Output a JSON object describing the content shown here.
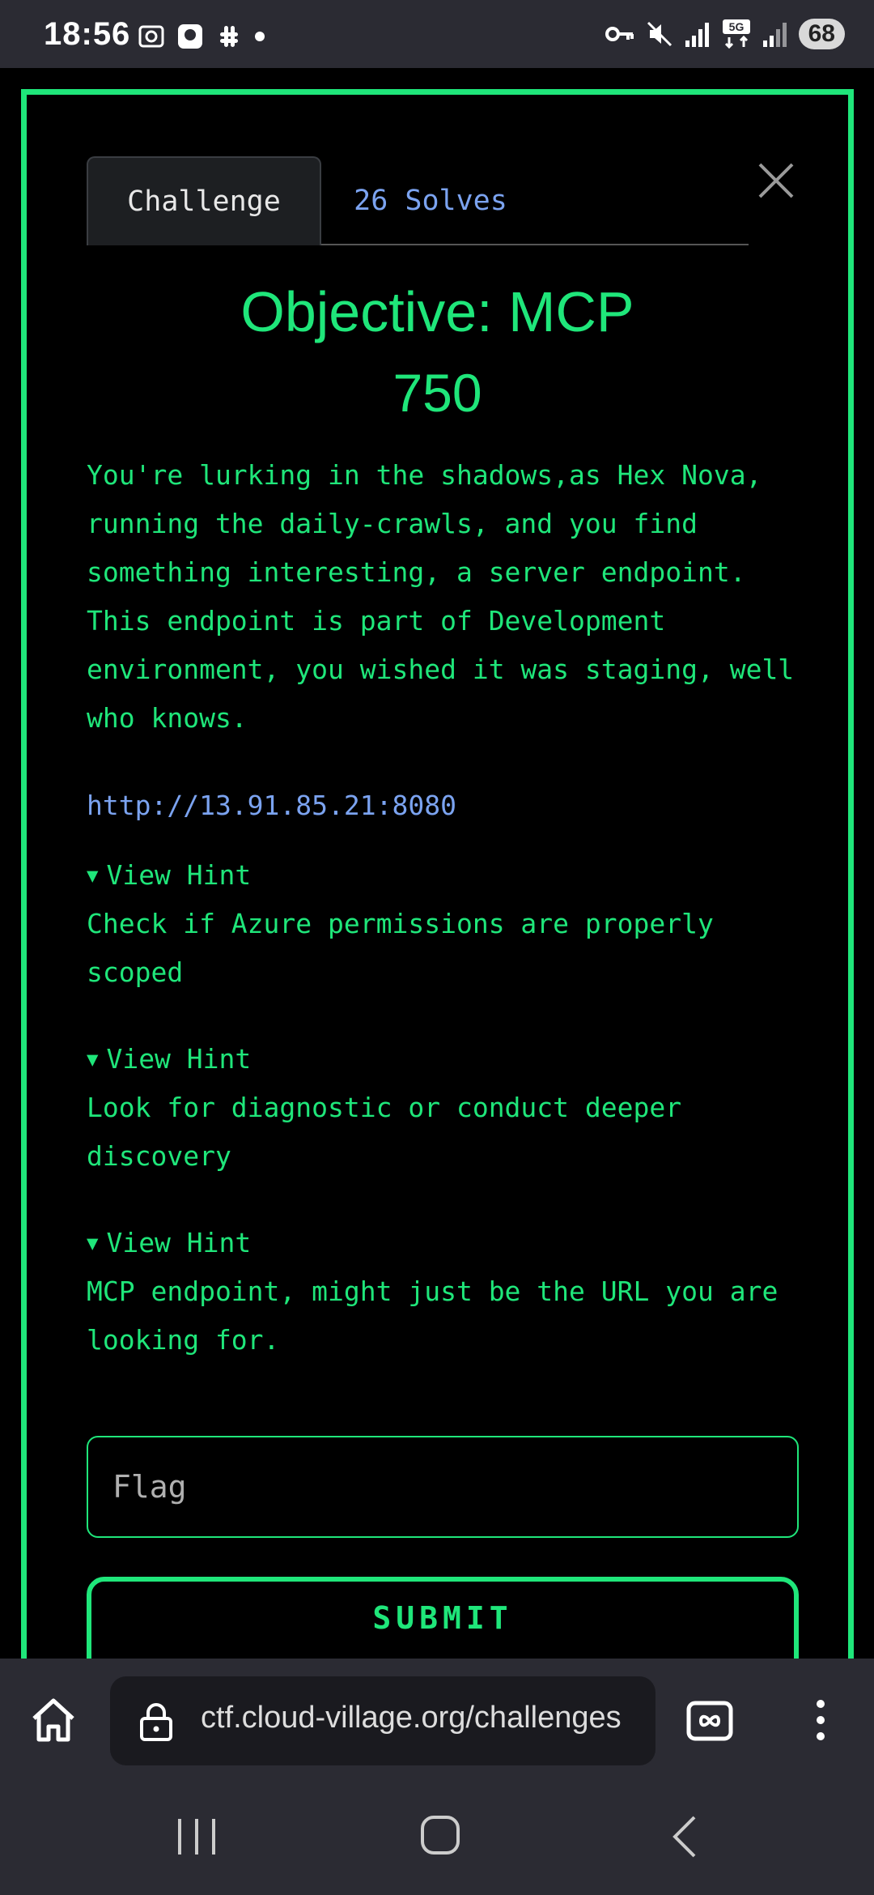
{
  "status_bar": {
    "time": "18:56",
    "battery": "68"
  },
  "modal": {
    "tabs": [
      {
        "label": "Challenge"
      },
      {
        "label": "26 Solves"
      }
    ],
    "title": "Objective: MCP",
    "points": "750",
    "description": "You're lurking in the shadows,as Hex Nova, running the daily-crawls, and you find something interesting, a server endpoint. This endpoint is part of Development environment, you wished it was staging, well who knows.",
    "endpoint": "http://13.91.85.21:8080",
    "hints": [
      {
        "toggle": "View Hint",
        "text": "Check if Azure permissions are properly scoped"
      },
      {
        "toggle": "View Hint",
        "text": "Look for diagnostic or conduct deeper discovery"
      },
      {
        "toggle": "View Hint",
        "text": "MCP endpoint, might just be the URL you are looking for."
      }
    ],
    "flag_placeholder": "Flag",
    "submit_label": "SUBMIT"
  },
  "browser": {
    "url": "ctf.cloud-village.org/challenges"
  },
  "colors": {
    "accent": "#1fe67a",
    "link": "#7ba3f0",
    "background": "#000000",
    "chrome": "#2b2b33"
  }
}
